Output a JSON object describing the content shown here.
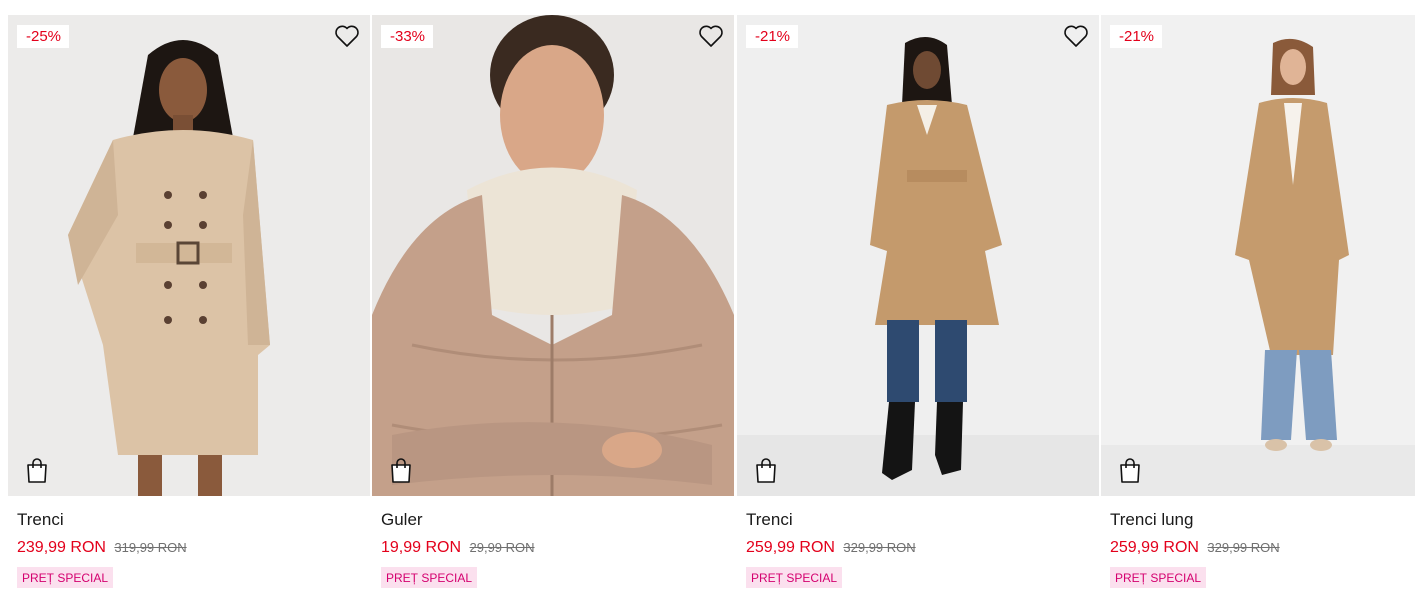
{
  "products": [
    {
      "discount": "-25%",
      "name": "Trenci",
      "price": "239,99 RON",
      "old_price": "319,99 RON",
      "tag": "PREȚ SPECIAL"
    },
    {
      "discount": "-33%",
      "name": "Guler",
      "price": "19,99 RON",
      "old_price": "29,99 RON",
      "tag": "PREȚ SPECIAL"
    },
    {
      "discount": "-21%",
      "name": "Trenci",
      "price": "259,99 RON",
      "old_price": "329,99 RON",
      "tag": "PREȚ SPECIAL"
    },
    {
      "discount": "-21%",
      "name": "Trenci lung",
      "price": "259,99 RON",
      "old_price": "329,99 RON",
      "tag": "PREȚ SPECIAL"
    }
  ],
  "icons": {
    "favorite": "heart-icon",
    "add_to_cart": "shopping-bag-icon"
  },
  "colors": {
    "discount_text": "#e3001b",
    "price_new": "#e3001b",
    "tag_bg": "#fbe0ee",
    "tag_text": "#d4006f"
  }
}
